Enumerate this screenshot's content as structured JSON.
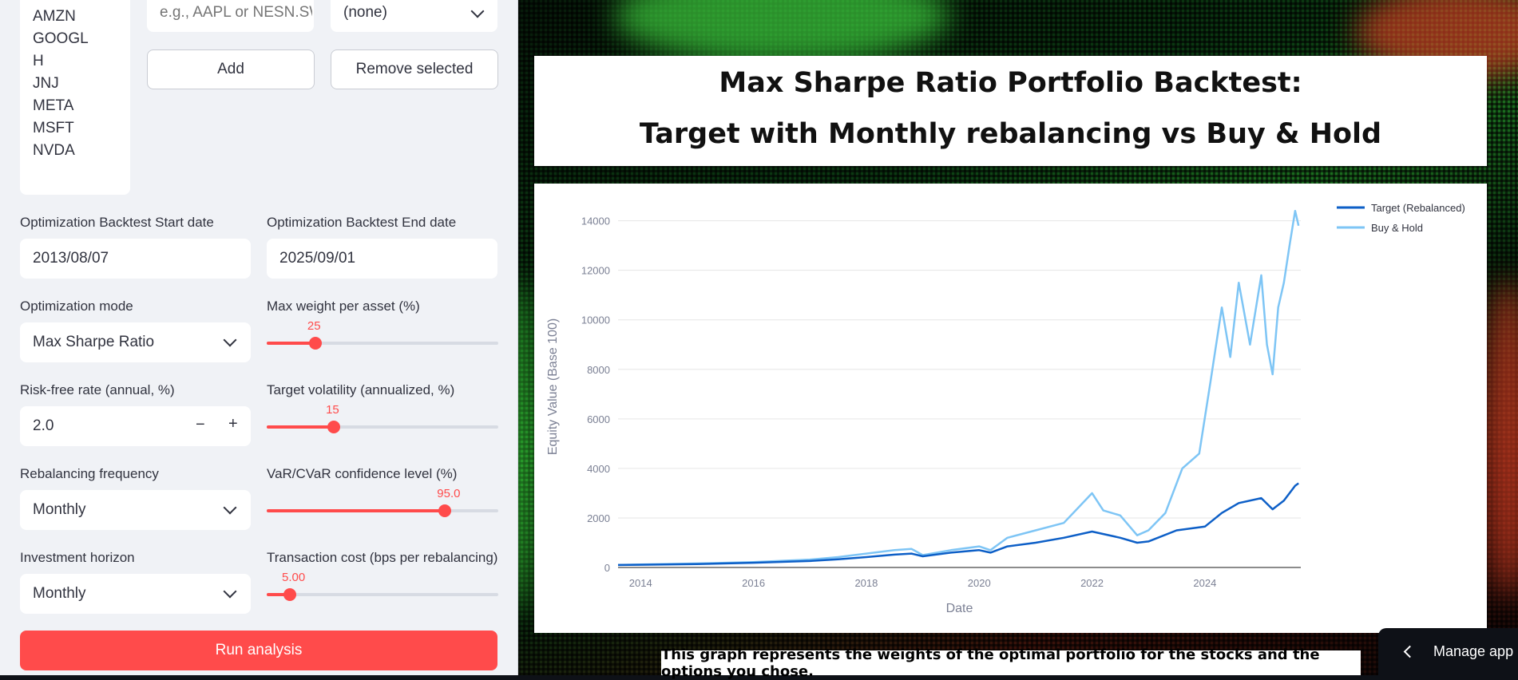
{
  "sidebar": {
    "tickers": [
      "AMZN",
      "GOOGL",
      "H",
      "JNJ",
      "META",
      "MSFT",
      "NVDA"
    ],
    "ticker_input_placeholder": "e.g., AAPL or NESN.SW",
    "ticker_select_value": "(none)",
    "add_label": "Add",
    "remove_label": "Remove selected",
    "start_date_label": "Optimization Backtest Start date",
    "start_date_value": "2013/08/07",
    "end_date_label": "Optimization Backtest End date",
    "end_date_value": "2025/09/01",
    "mode_label": "Optimization mode",
    "mode_value": "Max Sharpe Ratio",
    "max_weight_label": "Max weight per asset (%)",
    "max_weight_value": "25",
    "max_weight_fraction": 0.21,
    "rf_label": "Risk-free rate (annual, %)",
    "rf_value": "2.0",
    "stepper_minus": "−",
    "stepper_plus": "+",
    "target_vol_label": "Target volatility (annualized, %)",
    "target_vol_value": "15",
    "target_vol_fraction": 0.29,
    "rebal_label": "Rebalancing frequency",
    "rebal_value": "Monthly",
    "var_label": "VaR/CVaR confidence level (%)",
    "var_value": "95.0",
    "var_fraction": 0.77,
    "horizon_label": "Investment horizon",
    "horizon_value": "Monthly",
    "tc_label": "Transaction cost (bps per rebalancing)",
    "tc_value": "5.00",
    "tc_fraction": 0.1,
    "run_label": "Run analysis"
  },
  "main": {
    "title_line1": "Max Sharpe Ratio Portfolio Backtest:",
    "title_line2": "Target with Monthly rebalancing vs Buy & Hold",
    "caption": "This graph represents the weights of the optimal portfolio for the stocks and the options you chose.",
    "manage_label": "Manage app"
  },
  "colors": {
    "accent": "#ff4b4b",
    "series_target": "#0d5fc7",
    "series_bh": "#7ec5f5"
  },
  "chart_data": {
    "type": "line",
    "xlabel": "Date",
    "ylabel": "Equity Value (Base 100)",
    "xlim": [
      2013.6,
      2025.7
    ],
    "ylim": [
      0,
      14600
    ],
    "x_ticks": [
      2014,
      2016,
      2018,
      2020,
      2022,
      2024
    ],
    "y_ticks": [
      0,
      2000,
      4000,
      6000,
      8000,
      10000,
      12000,
      14000
    ],
    "legend_position": "top-right",
    "grid": true,
    "series": [
      {
        "name": "Target (Rebalanced)",
        "x": [
          2013.6,
          2014.0,
          2015.0,
          2016.0,
          2017.0,
          2017.5,
          2018.0,
          2018.5,
          2018.8,
          2019.0,
          2019.5,
          2020.0,
          2020.2,
          2020.5,
          2021.0,
          2021.5,
          2022.0,
          2022.5,
          2022.8,
          2023.0,
          2023.5,
          2024.0,
          2024.3,
          2024.6,
          2025.0,
          2025.2,
          2025.4,
          2025.6,
          2025.66
        ],
        "y": [
          100,
          110,
          140,
          190,
          260,
          330,
          420,
          520,
          560,
          450,
          600,
          700,
          600,
          850,
          1000,
          1200,
          1450,
          1200,
          1000,
          1050,
          1500,
          1650,
          2200,
          2600,
          2800,
          2350,
          2700,
          3300,
          3400
        ]
      },
      {
        "name": "Buy & Hold",
        "x": [
          2013.6,
          2014.0,
          2015.0,
          2016.0,
          2017.0,
          2017.5,
          2018.0,
          2018.5,
          2018.8,
          2019.0,
          2019.5,
          2020.0,
          2020.2,
          2020.5,
          2021.0,
          2021.5,
          2022.0,
          2022.2,
          2022.5,
          2022.8,
          2023.0,
          2023.3,
          2023.6,
          2023.9,
          2024.1,
          2024.3,
          2024.45,
          2024.6,
          2024.8,
          2025.0,
          2025.1,
          2025.2,
          2025.3,
          2025.4,
          2025.5,
          2025.6,
          2025.66
        ],
        "y": [
          100,
          120,
          160,
          220,
          320,
          420,
          560,
          700,
          750,
          500,
          700,
          850,
          700,
          1200,
          1500,
          1800,
          3000,
          2300,
          2100,
          1300,
          1500,
          2200,
          4000,
          4600,
          7500,
          10500,
          8500,
          11500,
          9000,
          11800,
          9000,
          7800,
          10500,
          11500,
          13000,
          14400,
          13800
        ]
      }
    ]
  }
}
